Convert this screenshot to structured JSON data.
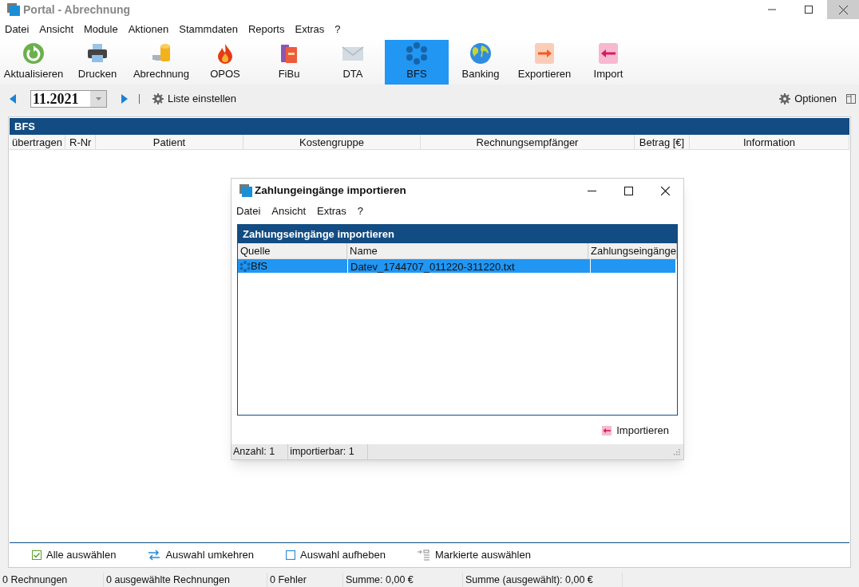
{
  "window": {
    "title": "Portal - Abrechnung"
  },
  "menu": [
    "Datei",
    "Ansicht",
    "Module",
    "Aktionen",
    "Stammdaten",
    "Reports",
    "Extras",
    "?"
  ],
  "toolbar": [
    {
      "label": "Aktualisieren",
      "selected": false
    },
    {
      "label": "Drucken",
      "selected": false
    },
    {
      "label": "Abrechnung",
      "selected": false
    },
    {
      "label": "OPOS",
      "selected": false
    },
    {
      "label": "FiBu",
      "selected": false
    },
    {
      "label": "DTA",
      "selected": false
    },
    {
      "label": "BFS",
      "selected": true
    },
    {
      "label": "Banking",
      "selected": false
    },
    {
      "label": "Exportieren",
      "selected": false
    },
    {
      "label": "Import",
      "selected": false
    }
  ],
  "period": {
    "value": "11.2021"
  },
  "list_settings": "Liste einstellen",
  "options": "Optionen",
  "panel": {
    "title": "BFS",
    "columns": [
      "übertragen",
      "R-Nr",
      "Patient",
      "Kostengruppe",
      "Rechnungsempfänger",
      "Betrag [€]",
      "Information"
    ]
  },
  "selection_actions": [
    {
      "label": "Alle auswählen"
    },
    {
      "label": "Auswahl umkehren"
    },
    {
      "label": "Auswahl aufheben"
    },
    {
      "label": "Markierte auswählen"
    }
  ],
  "status_bar": [
    "0 Rechnungen",
    "0 ausgewählte Rechnungen",
    "0 Fehler",
    "Summe: 0,00 €",
    "Summe (ausgewählt): 0,00 €"
  ],
  "dialog": {
    "title": "Zahlungeingänge importieren",
    "menu": [
      "Datei",
      "Ansicht",
      "Extras",
      "?"
    ],
    "panel_title": "Zahlungseingänge importieren",
    "columns": [
      "Quelle",
      "Name",
      "Zahlungseingänge"
    ],
    "rows": [
      {
        "source": "BfS",
        "name": "Datev_1744707_011220-311220.txt",
        "selected": true
      }
    ],
    "import_button": "Importieren",
    "status": [
      "Anzahl: 1",
      "importierbar: 1"
    ]
  }
}
